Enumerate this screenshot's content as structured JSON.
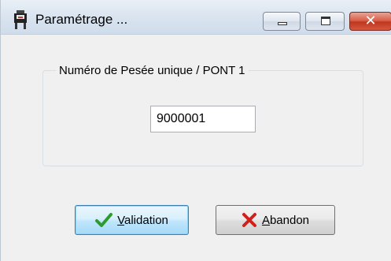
{
  "window": {
    "title": "Paramétrage ..."
  },
  "titlebar_buttons": {
    "minimize_icon": "minimize-icon",
    "maximize_icon": "maximize-icon",
    "close_glyph": "✕"
  },
  "group": {
    "label": "Numéro de Pesée unique / PONT 1",
    "value": "9000001"
  },
  "buttons": {
    "validation_first": "V",
    "validation_rest": "alidation",
    "abandon_first": "A",
    "abandon_rest": "bandon"
  },
  "colors": {
    "check": "#2e9b2e",
    "x_mark": "#d0201a"
  }
}
